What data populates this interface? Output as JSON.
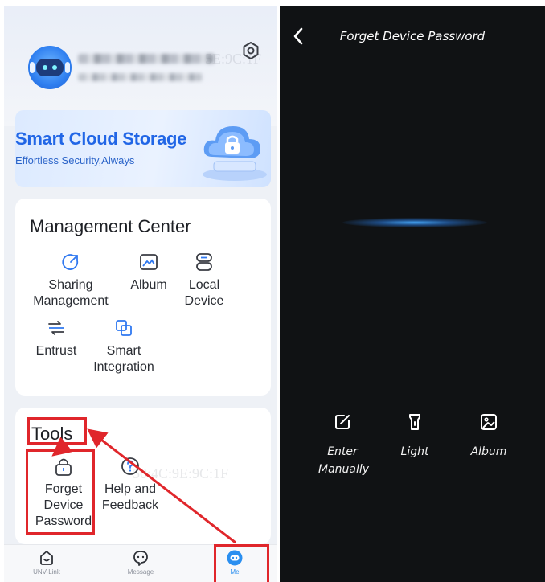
{
  "left_screen": {
    "banner": {
      "title": "Smart Cloud Storage",
      "subtitle": "Effortless Security,Always"
    },
    "watermark_1": "5E:9C:1F",
    "watermark_2": "50:4C:9E:9C:1F",
    "management_center": {
      "title": "Management Center",
      "items": [
        {
          "label": "Sharing Management",
          "icon": "share-icon"
        },
        {
          "label": "Album",
          "icon": "album-icon"
        },
        {
          "label": "Local Device",
          "icon": "local-device-icon"
        },
        {
          "label": "Entrust",
          "icon": "entrust-icon"
        },
        {
          "label": "Smart Integration",
          "icon": "smart-integration-icon"
        }
      ]
    },
    "tools": {
      "title": "Tools",
      "items": [
        {
          "label": "Forget Device Password",
          "icon": "lock-icon"
        },
        {
          "label": "Help and Feedback",
          "icon": "help-icon"
        }
      ]
    },
    "tabbar": [
      {
        "label": "UNV-Link",
        "icon": "home-icon"
      },
      {
        "label": "Message",
        "icon": "message-icon"
      },
      {
        "label": "Me",
        "icon": "me-icon",
        "active": true
      }
    ]
  },
  "right_screen": {
    "title": "Forget Device Password",
    "actions": [
      {
        "label": "Enter Manually",
        "icon": "edit-icon"
      },
      {
        "label": "Light",
        "icon": "light-icon"
      },
      {
        "label": "Album",
        "icon": "album-icon"
      }
    ]
  },
  "colors": {
    "accent": "#2166e6",
    "highlight": "#e0262b",
    "tab_active": "#2a8ff0",
    "dark_bg": "#101214"
  }
}
